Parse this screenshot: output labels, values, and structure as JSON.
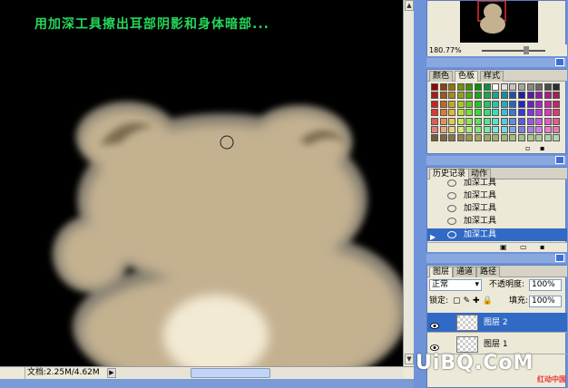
{
  "canvas": {
    "caption": "用加深工具擦出耳部阴影和身体暗部..."
  },
  "statusbar": {
    "doc_info": "文档:2.25M/4.62M"
  },
  "navigator": {
    "zoom": "180.77%"
  },
  "swatch_panel": {
    "tabs": [
      "颜色",
      "色板",
      "样式"
    ],
    "active_tab": "色板"
  },
  "history": {
    "tabs": [
      "历史记录",
      "动作"
    ],
    "items": [
      "加深工具",
      "加深工具",
      "加深工具",
      "加深工具",
      "加深工具"
    ]
  },
  "layers": {
    "tabs": [
      "图层",
      "通道",
      "路径"
    ],
    "blend_mode": "正常",
    "opacity_label": "不透明度:",
    "opacity_value": "100%",
    "lock_label": "锁定:",
    "fill_label": "填充:",
    "fill_value": "100%",
    "rows": [
      "图层 2",
      "图层 1"
    ]
  },
  "watermark": {
    "text": "UiBQ.CoM",
    "sub": "红动中国"
  }
}
